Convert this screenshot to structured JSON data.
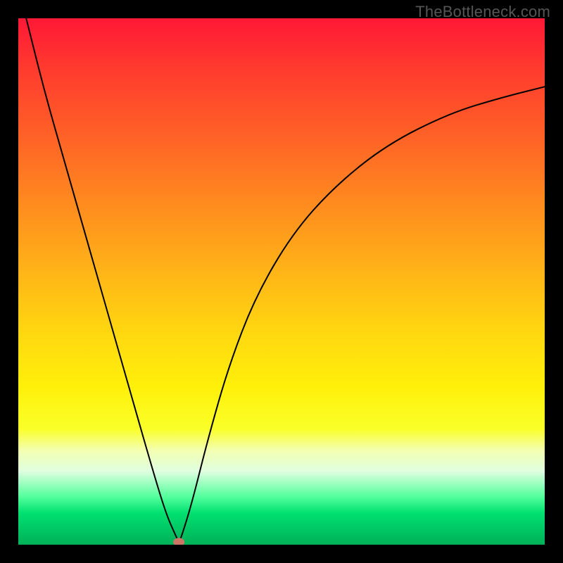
{
  "watermark": "TheBottleneck.com",
  "chart_data": {
    "type": "line",
    "title": "",
    "xlabel": "",
    "ylabel": "",
    "xlim": [
      0,
      1
    ],
    "ylim": [
      0,
      1
    ],
    "series": [
      {
        "name": "bottleneck-curve",
        "x": [
          0.015,
          0.05,
          0.09,
          0.13,
          0.17,
          0.21,
          0.25,
          0.28,
          0.3,
          0.305,
          0.31,
          0.33,
          0.36,
          0.4,
          0.45,
          0.52,
          0.6,
          0.7,
          0.82,
          0.92,
          1.0
        ],
        "y": [
          1.0,
          0.86,
          0.72,
          0.58,
          0.44,
          0.3,
          0.16,
          0.06,
          0.015,
          0.005,
          0.015,
          0.08,
          0.2,
          0.34,
          0.47,
          0.59,
          0.68,
          0.76,
          0.82,
          0.85,
          0.87
        ]
      }
    ],
    "annotations": [
      {
        "label": "optimum-point",
        "x": 0.305,
        "y": 0.005
      }
    ],
    "gradient_legend": {
      "top_color": "#ff1836",
      "bottom_color": "#00b058",
      "meaning_top": "high-bottleneck",
      "meaning_bottom": "no-bottleneck"
    }
  }
}
